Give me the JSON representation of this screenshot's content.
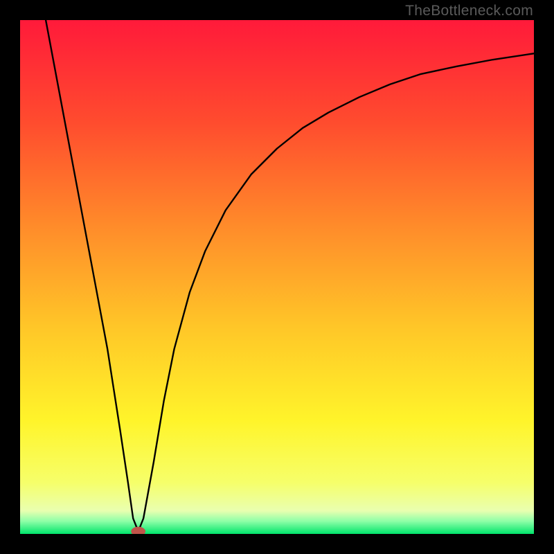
{
  "watermark": "TheBottleneck.com",
  "chart_data": {
    "type": "line",
    "title": "",
    "xlabel": "",
    "ylabel": "",
    "xlim": [
      0,
      100
    ],
    "ylim": [
      0,
      100
    ],
    "grid": false,
    "background": {
      "type": "vertical-gradient",
      "stops": [
        {
          "offset": 0.0,
          "color": "#ff1a3a"
        },
        {
          "offset": 0.2,
          "color": "#ff4c2e"
        },
        {
          "offset": 0.4,
          "color": "#ff8b2a"
        },
        {
          "offset": 0.6,
          "color": "#ffc728"
        },
        {
          "offset": 0.78,
          "color": "#fff42a"
        },
        {
          "offset": 0.9,
          "color": "#f6ff6a"
        },
        {
          "offset": 0.955,
          "color": "#e9ffb0"
        },
        {
          "offset": 0.975,
          "color": "#8fffa8"
        },
        {
          "offset": 1.0,
          "color": "#00e56b"
        }
      ]
    },
    "series": [
      {
        "name": "bottleneck-curve",
        "stroke": "#000000",
        "x": [
          5,
          8,
          11,
          14,
          17,
          19.5,
          21,
          22,
          23,
          24,
          26,
          28,
          30,
          33,
          36,
          40,
          45,
          50,
          55,
          60,
          66,
          72,
          78,
          85,
          92,
          100
        ],
        "y": [
          100,
          84,
          68,
          52,
          36,
          20,
          10,
          3,
          0.5,
          3,
          14,
          26,
          36,
          47,
          55,
          63,
          70,
          75,
          79,
          82,
          85,
          87.5,
          89.5,
          91,
          92.3,
          93.5
        ]
      }
    ],
    "markers": [
      {
        "name": "optimal-point",
        "x": 23,
        "y": 0.5,
        "rx": 1.4,
        "ry": 0.9,
        "color": "#c0544a"
      }
    ]
  }
}
